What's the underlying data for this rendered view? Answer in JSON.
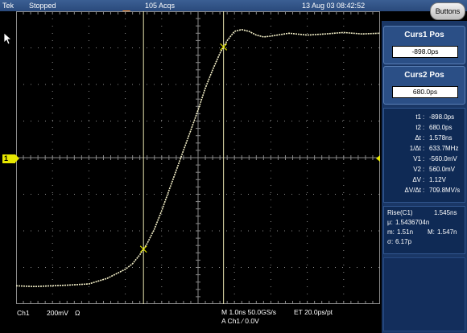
{
  "topbar": {
    "brand": "Tek",
    "status": "Stopped",
    "acqs": "105 Acqs",
    "datetime": "13 Aug 03 08:42:52",
    "buttons_label": "Buttons"
  },
  "cursors": {
    "curs1": {
      "title": "Curs1 Pos",
      "value": "-898.0ps"
    },
    "curs2": {
      "title": "Curs2 Pos",
      "value": "680.0ps"
    }
  },
  "readouts": [
    {
      "label": "t1",
      "value": "-898.0ps"
    },
    {
      "label": "t2",
      "value": "680.0ps"
    },
    {
      "label": "Δt",
      "value": "1.578ns"
    },
    {
      "label": "1/Δt",
      "value": "633.7MHz"
    },
    {
      "label": "V1",
      "value": "-560.0mV"
    },
    {
      "label": "V2",
      "value": "560.0mV"
    },
    {
      "label": "ΔV",
      "value": "1.12V"
    },
    {
      "label": "ΔV/Δt",
      "value": "709.8MV/s"
    }
  ],
  "rise": {
    "title": "Rise(C1)",
    "value": "1.545ns",
    "mu_label": "μ:",
    "mu": "1.5436704n",
    "m_label": "m:",
    "m": "1.51n",
    "M_label": "M:",
    "M": "1.547n",
    "sigma_label": "σ:",
    "sigma": "6.17p"
  },
  "bottombar": {
    "channel": "Ch1",
    "scale": "200mV",
    "impedance": "Ω",
    "timebase": "M 1.0ns 50.0GS/s",
    "et": "ET 20.0ps/pt",
    "trigger": "A  Ch1  ∕  0.0V"
  },
  "channel_marker": "1",
  "colors": {
    "trace": "#f4f0c8",
    "grid": "#8a8a8a",
    "panel_bg": "#1a3766",
    "marker_yellow": "#e8e800",
    "trigger_orange": "#ff8a1f"
  },
  "chart_data": {
    "type": "line",
    "title": "",
    "xlabel": "",
    "ylabel": "",
    "xlim": [
      -5,
      5
    ],
    "ylim": [
      -4,
      4
    ],
    "grid": true,
    "series": [
      {
        "x": [
          -5.0,
          -4.5,
          -4.0,
          -3.5,
          -3.0,
          -2.5,
          -2.0,
          -1.8,
          -1.6,
          -1.4,
          -1.2,
          -1.0,
          -0.8,
          -0.6,
          -0.4,
          -0.2,
          0.0,
          0.2,
          0.4,
          0.6,
          0.8,
          1.0,
          1.2,
          1.4,
          1.6,
          1.8,
          2.0,
          2.5,
          3.0,
          3.5,
          4.0,
          4.5,
          5.0
        ],
        "y": [
          -3.5,
          -3.52,
          -3.5,
          -3.48,
          -3.45,
          -3.3,
          -3.05,
          -2.9,
          -2.65,
          -2.35,
          -1.95,
          -1.45,
          -0.9,
          -0.35,
          0.2,
          0.75,
          1.3,
          1.9,
          2.4,
          2.85,
          3.2,
          3.45,
          3.5,
          3.45,
          3.35,
          3.3,
          3.32,
          3.4,
          3.35,
          3.38,
          3.42,
          3.38,
          3.4
        ]
      }
    ],
    "cursors_x": [
      -1.5,
      0.7
    ]
  }
}
